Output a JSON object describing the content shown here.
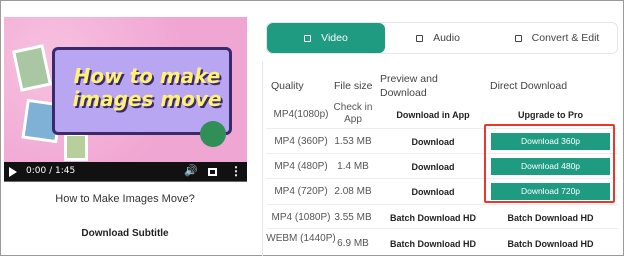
{
  "player": {
    "overlay_title": "How to make images move",
    "time": "0:00 / 1:45"
  },
  "video_title": "How to Make Images Move?",
  "download_subtitle": "Download Subtitle",
  "tabs": [
    {
      "label": "Video",
      "active": true
    },
    {
      "label": "Audio",
      "active": false
    },
    {
      "label": "Convert & Edit",
      "active": false
    }
  ],
  "table": {
    "headers": {
      "quality": "Quality",
      "file_size": "File size",
      "preview": "Preview and Download",
      "direct": "Direct Download"
    },
    "rows": [
      {
        "quality": "MP4(1080p)",
        "size": "Check in App",
        "preview": "Download in App",
        "direct": "Upgrade to Pro"
      },
      {
        "quality": "MP4 (360P)",
        "size": "1.53 MB",
        "preview": "Download",
        "direct": "Download 360p"
      },
      {
        "quality": "MP4 (480P)",
        "size": "1.4 MB",
        "preview": "Download",
        "direct": "Download 480p"
      },
      {
        "quality": "MP4 (720P)",
        "size": "2.08 MB",
        "preview": "Download",
        "direct": "Download 720p"
      },
      {
        "quality": "MP4 (1080P)",
        "size": "3.55 MB",
        "preview": "Batch Download HD",
        "direct": "Batch Download HD"
      },
      {
        "quality": "WEBM (1440P)",
        "size": "6.9 MB",
        "preview": "Batch Download HD",
        "direct": "Batch Download HD"
      }
    ]
  },
  "colors": {
    "accent": "#1e9b81",
    "highlight": "#e8392f"
  }
}
